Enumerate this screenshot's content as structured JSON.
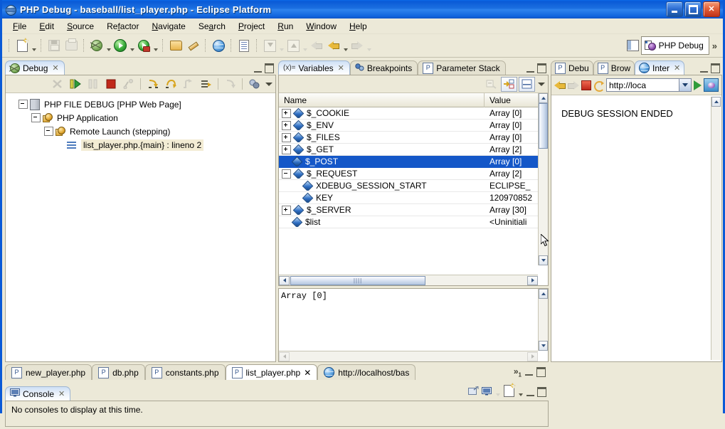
{
  "window": {
    "title": "PHP Debug - baseball/list_player.php - Eclipse Platform",
    "buttons": {
      "minimize": "_",
      "maximize": "□",
      "close": "✕"
    }
  },
  "menubar": {
    "items": [
      "File",
      "Edit",
      "Source",
      "Refactor",
      "Navigate",
      "Search",
      "Project",
      "Run",
      "Window",
      "Help"
    ]
  },
  "toolbar": {
    "icons": [
      "new-file-icon",
      "save-icon",
      "print-icon",
      "debug-icon",
      "run-icon",
      "run-last-tool-icon",
      "open-type-icon",
      "pencil-icon",
      "open-web-browser-icon",
      "new-php-file-icon",
      "import-icon",
      "export-icon",
      "back-icon",
      "forward-icon"
    ],
    "perspective_label": "PHP Debug",
    "overflow": "»"
  },
  "debug_view": {
    "tab_label": "Debug",
    "tab_close": "✕",
    "toolbar_icons": [
      "disconnect-icon",
      "resume-icon",
      "suspend-icon",
      "terminate-icon",
      "disconnect2-icon",
      "step-into-icon",
      "step-over-icon",
      "step-return-icon",
      "drop-to-frame-icon",
      "use-step-filters-icon",
      "view-menu-icon"
    ],
    "tree": [
      {
        "label": "PHP FILE DEBUG [PHP Web Page]",
        "indent": 0,
        "expander": "minus",
        "icon": "launch-config-icon"
      },
      {
        "label": "PHP Application",
        "indent": 1,
        "expander": "minus",
        "icon": "php-application-icon"
      },
      {
        "label": "Remote Launch (stepping)",
        "indent": 2,
        "expander": "minus",
        "icon": "php-application-icon"
      },
      {
        "label": "list_player.php.{main} : lineno 2",
        "indent": 3,
        "expander": "none",
        "icon": "thread-icon",
        "selected": true
      }
    ]
  },
  "variables_view": {
    "tabs": [
      {
        "label": "Variables",
        "icon": "variables-icon",
        "active": true,
        "close": "✕"
      },
      {
        "label": "Breakpoints",
        "icon": "breakpoints-icon",
        "active": false
      },
      {
        "label": "Parameter Stack",
        "icon": "php-icon",
        "active": false
      }
    ],
    "toolbar_icons": [
      "collapse-all-icon",
      "show-type-names-icon",
      "show-detail-pane-icon",
      "view-menu-icon"
    ],
    "columns": [
      "Name",
      "Value"
    ],
    "rows": [
      {
        "name": "$_COOKIE",
        "value": "Array [0]",
        "expander": "plus",
        "indent": 0
      },
      {
        "name": "$_ENV",
        "value": "Array [0]",
        "expander": "plus",
        "indent": 0
      },
      {
        "name": "$_FILES",
        "value": "Array [0]",
        "expander": "plus",
        "indent": 0
      },
      {
        "name": "$_GET",
        "value": "Array [2]",
        "expander": "plus",
        "indent": 0
      },
      {
        "name": "$_POST",
        "value": "Array [0]",
        "expander": "none",
        "indent": 0,
        "selected": true
      },
      {
        "name": "$_REQUEST",
        "value": "Array [2]",
        "expander": "minus",
        "indent": 0
      },
      {
        "name": "XDEBUG_SESSION_START",
        "value": "ECLIPSE_",
        "expander": "none",
        "indent": 1
      },
      {
        "name": "KEY",
        "value": "120970852",
        "expander": "none",
        "indent": 1
      },
      {
        "name": "$_SERVER",
        "value": "Array [30]",
        "expander": "plus",
        "indent": 0
      },
      {
        "name": "$list",
        "value": "<Uninitiali",
        "expander": "none",
        "indent": 0
      }
    ],
    "detail_value": "Array [0]"
  },
  "browser_view": {
    "tabs": [
      {
        "label": "Debu",
        "icon": "php-icon",
        "active": false
      },
      {
        "label": "Brow",
        "icon": "php-icon",
        "active": false
      },
      {
        "label": "Inter",
        "icon": "globe-icon",
        "active": true,
        "close": "✕"
      }
    ],
    "toolbar_icons": [
      "back-icon",
      "forward-icon",
      "stop-icon",
      "refresh-icon",
      "go-icon",
      "favorites-icon"
    ],
    "url": "http://loca",
    "content": "DEBUG SESSION ENDED"
  },
  "editor_area": {
    "tabs": [
      {
        "label": "new_player.php",
        "icon": "php-file-icon",
        "active": false
      },
      {
        "label": "db.php",
        "icon": "php-file-icon",
        "active": false
      },
      {
        "label": "constants.php",
        "icon": "php-file-icon",
        "active": false
      },
      {
        "label": "list_player.php",
        "icon": "php-file-icon",
        "active": true,
        "close": "✕"
      },
      {
        "label": "http://localhost/bas",
        "icon": "globe-icon",
        "active": false
      }
    ],
    "overflow": "»",
    "overflow_count": "1"
  },
  "console_view": {
    "tab_label": "Console",
    "tab_close": "✕",
    "message": "No consoles to display at this time.",
    "toolbar_icons": [
      "open-console-icon",
      "display-selected-console-icon",
      "new-console-view-icon"
    ]
  },
  "colors": {
    "title_bar": "#0a5ad7",
    "selection": "#1457c8",
    "chrome": "#ece9d8",
    "tab_active": "#ffffff"
  }
}
